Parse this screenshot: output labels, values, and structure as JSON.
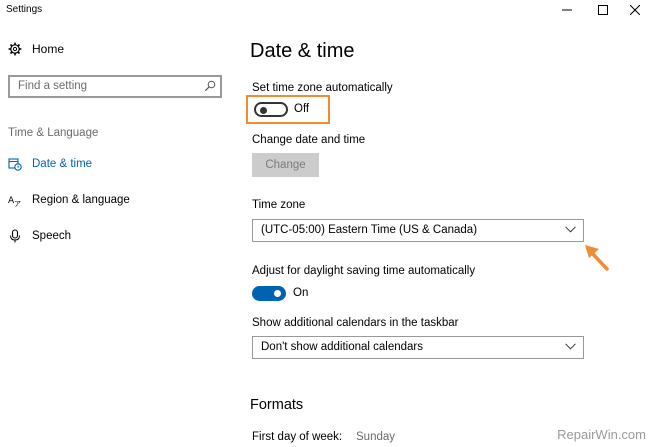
{
  "window": {
    "title": "Settings",
    "controls": {
      "minimize": "minimize-icon",
      "maximize": "maximize-icon",
      "close": "close-icon"
    }
  },
  "sidebar": {
    "home": {
      "label": "Home",
      "icon": "gear-icon"
    },
    "search": {
      "placeholder": "Find a setting",
      "icon": "search-icon"
    },
    "section": "Time & Language",
    "items": [
      {
        "label": "Date & time",
        "icon": "calendar-clock-icon",
        "active": true
      },
      {
        "label": "Region & language",
        "icon": "language-icon",
        "active": false
      },
      {
        "label": "Speech",
        "icon": "microphone-icon",
        "active": false
      }
    ]
  },
  "main": {
    "title": "Date & time",
    "auto_timezone": {
      "label": "Set time zone automatically",
      "state": "Off"
    },
    "change_date": {
      "label": "Change date and time",
      "button": "Change"
    },
    "timezone": {
      "label": "Time zone",
      "value": "(UTC-05:00) Eastern Time (US & Canada)"
    },
    "daylight": {
      "label": "Adjust for daylight saving time automatically",
      "state": "On"
    },
    "calendars": {
      "label": "Show additional calendars in the taskbar",
      "value": "Don't show additional calendars"
    },
    "formats": {
      "title": "Formats",
      "first_day_label": "First day of week:",
      "first_day_value": "Sunday"
    }
  },
  "annotation": {
    "highlight_color": "#f08c36",
    "arrow_color": "#f08c36"
  },
  "watermark": "RepairWin.com",
  "colors": {
    "accent": "#0063b1",
    "highlight": "#f08c36"
  }
}
